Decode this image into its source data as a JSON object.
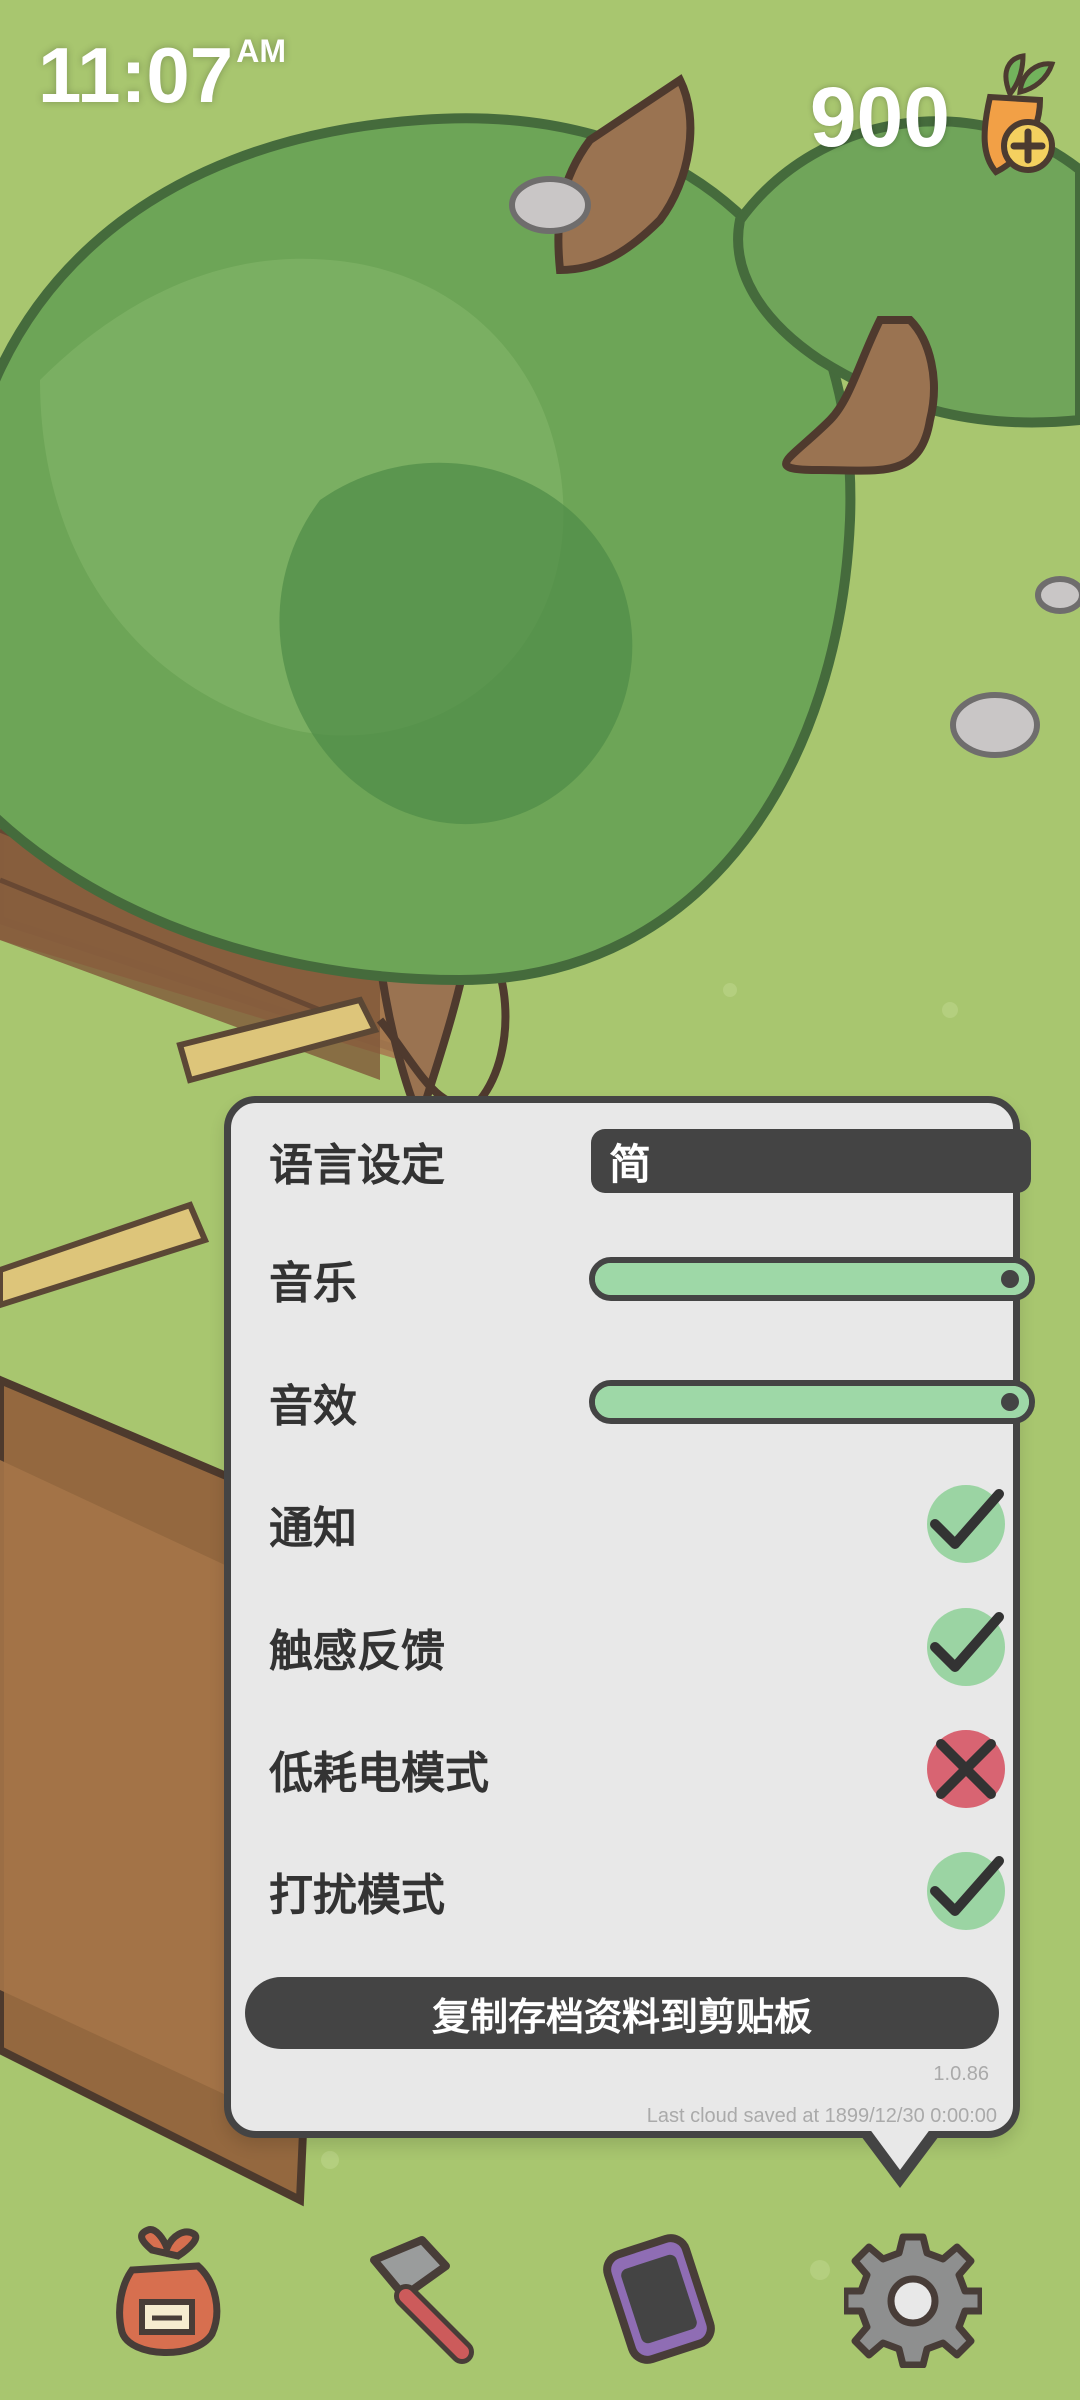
{
  "status_bar": {
    "time": "11:07",
    "ampm": "AM"
  },
  "currency": {
    "value": "900",
    "icon": "carrot-plus-icon"
  },
  "settings": {
    "language": {
      "label": "语言设定",
      "value": "简"
    },
    "music": {
      "label": "音乐",
      "level": 1.0
    },
    "sound_effects": {
      "label": "音效",
      "level": 1.0
    },
    "notifications": {
      "label": "通知",
      "enabled": true
    },
    "haptics": {
      "label": "触感反馈",
      "enabled": true
    },
    "low_power_mode": {
      "label": "低耗电模式",
      "enabled": false
    },
    "do_not_disturb": {
      "label": "打扰模式",
      "enabled": true
    },
    "copy_button": "复制存档资料到剪贴板",
    "version": "1.0.86",
    "cloud_status": "Last cloud saved at 1899/12/30 0:00:00"
  },
  "toolbar": [
    {
      "name": "supplies-bag-icon"
    },
    {
      "name": "build-hammer-icon"
    },
    {
      "name": "phone-icon"
    },
    {
      "name": "settings-gear-icon"
    }
  ]
}
